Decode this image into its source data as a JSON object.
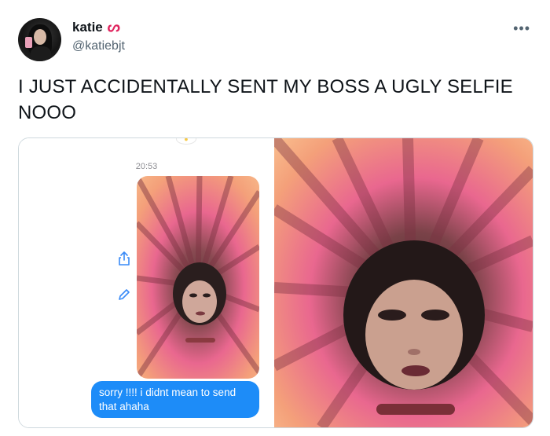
{
  "tweet": {
    "author": {
      "display_name": "katie",
      "name_emoji": "ᔕ",
      "handle": "@katiebjt"
    },
    "more_icon": "•••",
    "text": "I JUST ACCIDENTALLY SENT MY BOSS A UGLY SELFIE NOOO"
  },
  "media": {
    "screenshot": {
      "timestamp": "20:53",
      "message": "sorry !!!! i didnt mean to send that ahaha",
      "icons": [
        "share-icon",
        "edit-icon"
      ],
      "bubble_color": "#1d8cf8"
    },
    "photo": {
      "dominant_colors": [
        "#e9678f",
        "#f4a07a",
        "#3a2a28"
      ]
    }
  }
}
